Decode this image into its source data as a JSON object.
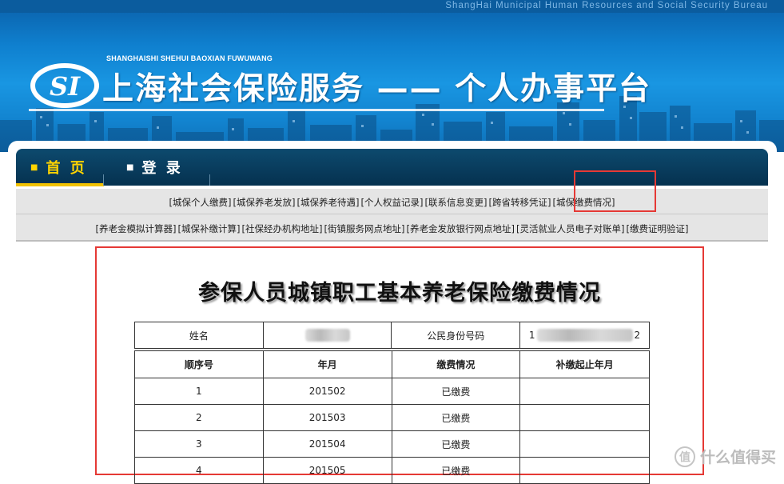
{
  "header": {
    "bureau_text": "ShangHai Municipal Human Resources and Social Security Bureau",
    "logo_letters": "SI",
    "pinyin": "SHANGHAISHI SHEHUI BAOXIAN FUWUWANG",
    "site_title": "上海社会保险服务 —— 个人办事平台"
  },
  "nav": {
    "home": "首 页",
    "login": "登 录",
    "bullet": "■"
  },
  "submenu_row1": [
    "[城保个人缴费]",
    "[城保养老发放]",
    "[城保养老待遇]",
    "[个人权益记录]",
    "[联系信息变更]",
    "[跨省转移凭证]",
    "[城保缴费情况]"
  ],
  "submenu_row2": [
    "[养老金模拟计算器]",
    "[城保补缴计算]",
    "[社保经办机构地址]",
    "[街镇服务网点地址]",
    "[养老金发放银行网点地址]",
    "[灵活就业人员电子对账单]",
    "[缴费证明验证]"
  ],
  "page": {
    "heading": "参保人员城镇职工基本养老保险缴费情况",
    "name_label": "姓名",
    "id_label": "公民身份号码",
    "id_first_char": "1",
    "id_last_char": "2"
  },
  "table": {
    "headers": [
      "顺序号",
      "年月",
      "缴费情况",
      "补缴起止年月"
    ],
    "rows": [
      [
        "1",
        "201502",
        "已缴费",
        ""
      ],
      [
        "2",
        "201503",
        "已缴费",
        ""
      ],
      [
        "3",
        "201504",
        "已缴费",
        ""
      ],
      [
        "4",
        "201505",
        "已缴费",
        ""
      ]
    ]
  },
  "watermark": {
    "icon_glyph": "值",
    "text": "什么值得买"
  },
  "colors": {
    "nav_active": "#ffd400",
    "annotation_red": "#e53935",
    "banner_blue": "#1283cf"
  }
}
